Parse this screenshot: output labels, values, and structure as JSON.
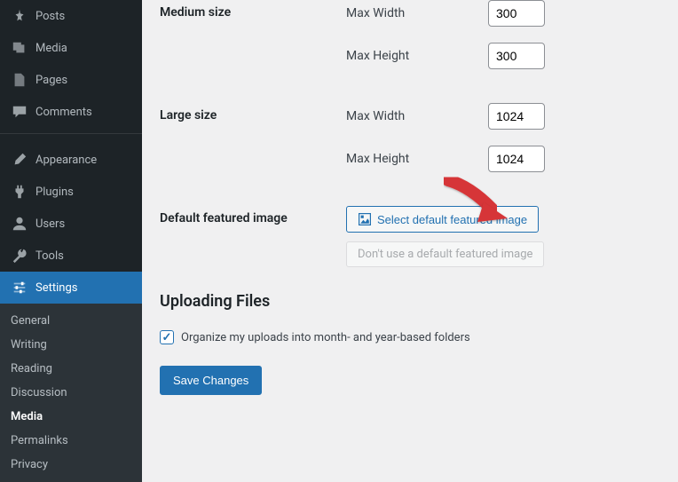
{
  "sidebar": {
    "main": [
      {
        "label": "Posts",
        "icon": "pin"
      },
      {
        "label": "Media",
        "icon": "media"
      },
      {
        "label": "Pages",
        "icon": "pages"
      },
      {
        "label": "Comments",
        "icon": "comments"
      }
    ],
    "admin": [
      {
        "label": "Appearance",
        "icon": "brush"
      },
      {
        "label": "Plugins",
        "icon": "plug"
      },
      {
        "label": "Users",
        "icon": "user"
      },
      {
        "label": "Tools",
        "icon": "wrench"
      },
      {
        "label": "Settings",
        "icon": "sliders",
        "current": true
      }
    ],
    "sub": [
      {
        "label": "General"
      },
      {
        "label": "Writing"
      },
      {
        "label": "Reading"
      },
      {
        "label": "Discussion"
      },
      {
        "label": "Media",
        "current": true
      },
      {
        "label": "Permalinks"
      },
      {
        "label": "Privacy"
      }
    ]
  },
  "form": {
    "medium_size": {
      "label": "Medium size",
      "max_width_label": "Max Width",
      "max_width_value": "300",
      "max_height_label": "Max Height",
      "max_height_value": "300"
    },
    "large_size": {
      "label": "Large size",
      "max_width_label": "Max Width",
      "max_width_value": "1024",
      "max_height_label": "Max Height",
      "max_height_value": "1024"
    },
    "featured": {
      "label": "Default featured image",
      "select_btn": "Select default featured image",
      "remove_btn": "Don't use a default featured image"
    },
    "uploading": {
      "heading": "Uploading Files",
      "organize_label": "Organize my uploads into month- and year-based folders",
      "organize_checked": true
    },
    "save_btn": "Save Changes"
  }
}
